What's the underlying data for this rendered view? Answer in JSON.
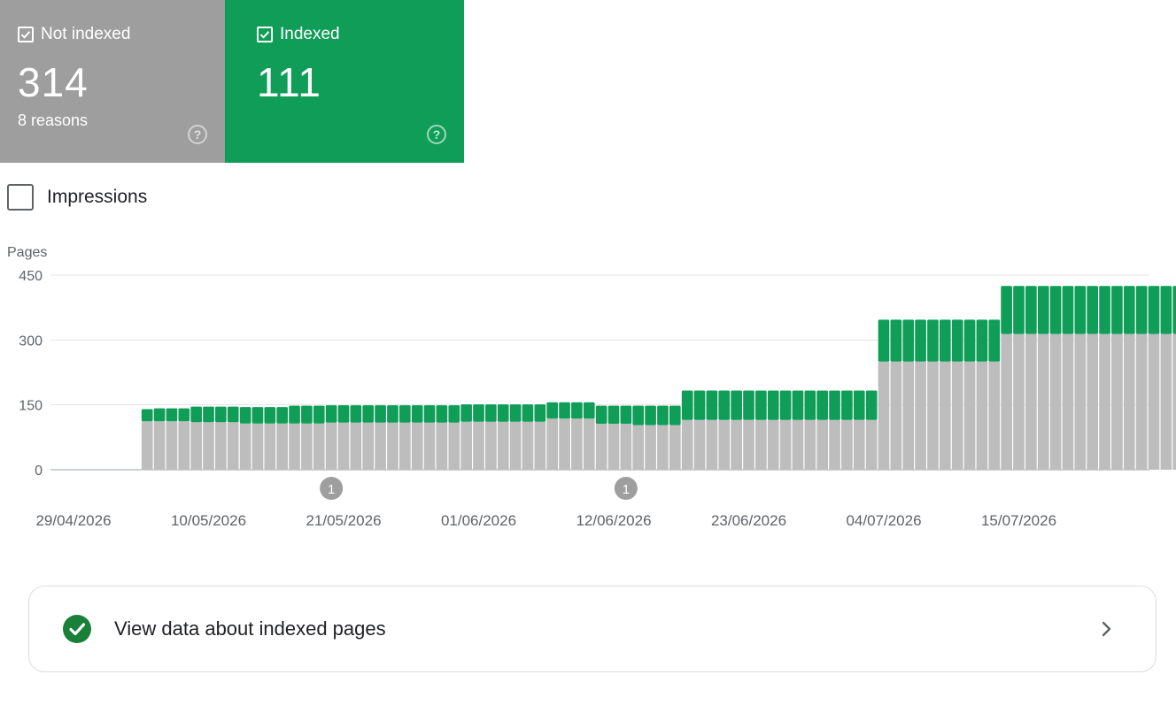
{
  "cards": {
    "not_indexed": {
      "label": "Not indexed",
      "value": "314",
      "sub": "8 reasons",
      "color": "#9e9e9e",
      "checked": true
    },
    "indexed": {
      "label": "Indexed",
      "value": "111",
      "color": "#0f9d58",
      "checked": true
    }
  },
  "impressions": {
    "label": "Impressions",
    "checked": false
  },
  "chart_data": {
    "type": "bar",
    "stacked": true,
    "ylabel": "Pages",
    "ylim": [
      0,
      450
    ],
    "yticks": [
      0,
      150,
      300,
      450
    ],
    "x_tick_labels": [
      "29/04/2026",
      "10/05/2026",
      "21/05/2026",
      "01/06/2026",
      "12/06/2026",
      "23/06/2026",
      "04/07/2026",
      "15/07/2026"
    ],
    "categories": [
      "05/05/2026",
      "06/05/2026",
      "07/05/2026",
      "08/05/2026",
      "09/05/2026",
      "10/05/2026",
      "11/05/2026",
      "12/05/2026",
      "13/05/2026",
      "14/05/2026",
      "15/05/2026",
      "16/05/2026",
      "17/05/2026",
      "18/05/2026",
      "19/05/2026",
      "20/05/2026",
      "21/05/2026",
      "22/05/2026",
      "23/05/2026",
      "24/05/2026",
      "25/05/2026",
      "26/05/2026",
      "27/05/2026",
      "28/05/2026",
      "29/05/2026",
      "30/05/2026",
      "31/05/2026",
      "01/06/2026",
      "02/06/2026",
      "03/06/2026",
      "04/06/2026",
      "05/06/2026",
      "06/06/2026",
      "07/06/2026",
      "08/06/2026",
      "09/06/2026",
      "10/06/2026",
      "11/06/2026",
      "12/06/2026",
      "13/06/2026",
      "14/06/2026",
      "15/06/2026",
      "16/06/2026",
      "17/06/2026",
      "18/06/2026",
      "19/06/2026",
      "20/06/2026",
      "21/06/2026",
      "22/06/2026",
      "23/06/2026",
      "24/06/2026",
      "25/06/2026",
      "26/06/2026",
      "27/06/2026",
      "28/06/2026",
      "29/06/2026",
      "30/06/2026",
      "01/07/2026",
      "02/07/2026",
      "03/07/2026",
      "04/07/2026",
      "05/07/2026",
      "06/07/2026",
      "07/07/2026",
      "08/07/2026",
      "09/07/2026",
      "10/07/2026",
      "11/07/2026",
      "12/07/2026",
      "13/07/2026",
      "14/07/2026",
      "15/07/2026",
      "16/07/2026",
      "17/07/2026",
      "18/07/2026",
      "19/07/2026",
      "20/07/2026",
      "21/07/2026",
      "22/07/2026",
      "23/07/2026",
      "24/07/2026",
      "25/07/2026",
      "26/07/2026",
      "27/07/2026",
      "28/07/2026"
    ],
    "series": [
      {
        "name": "Not indexed",
        "color": "#bdbdbd",
        "values": [
          112,
          112,
          112,
          112,
          110,
          110,
          110,
          110,
          107,
          107,
          107,
          107,
          107,
          107,
          107,
          109,
          109,
          109,
          109,
          109,
          109,
          109,
          109,
          109,
          109,
          109,
          111,
          111,
          111,
          111,
          111,
          111,
          111,
          118,
          118,
          118,
          118,
          106,
          106,
          106,
          103,
          103,
          103,
          103,
          115,
          115,
          115,
          115,
          115,
          115,
          115,
          115,
          115,
          115,
          115,
          115,
          115,
          115,
          115,
          115,
          250,
          250,
          250,
          250,
          250,
          250,
          250,
          250,
          250,
          250,
          314,
          314,
          314,
          314,
          314,
          314,
          314,
          314,
          314,
          314,
          314,
          314,
          314,
          314,
          314
        ]
      },
      {
        "name": "Indexed",
        "color": "#0f9d58",
        "values": [
          28,
          30,
          30,
          30,
          36,
          36,
          36,
          36,
          38,
          38,
          38,
          38,
          41,
          41,
          41,
          40,
          40,
          40,
          40,
          40,
          40,
          40,
          40,
          40,
          40,
          40,
          40,
          40,
          40,
          40,
          40,
          40,
          40,
          38,
          38,
          38,
          38,
          42,
          42,
          42,
          45,
          45,
          45,
          45,
          68,
          68,
          68,
          68,
          68,
          68,
          68,
          68,
          68,
          68,
          68,
          68,
          68,
          68,
          68,
          68,
          97,
          97,
          97,
          97,
          97,
          97,
          97,
          97,
          97,
          97,
          111,
          111,
          111,
          111,
          111,
          111,
          111,
          111,
          111,
          111,
          111,
          111,
          111,
          111,
          111
        ]
      }
    ],
    "annotations": [
      {
        "label": "1",
        "x": "20/05/2026"
      },
      {
        "label": "1",
        "x": "13/06/2026"
      }
    ],
    "grid": true
  },
  "link": {
    "label": "View data about indexed pages"
  }
}
